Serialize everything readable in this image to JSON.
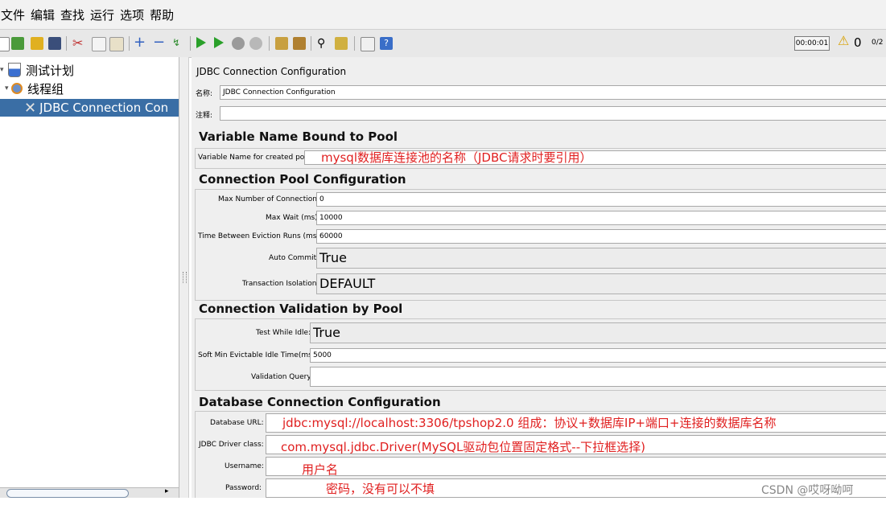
{
  "menu": [
    "文件",
    "编辑",
    "查找",
    "运行",
    "选项",
    "帮助"
  ],
  "toolbar": {
    "timer": "00:00:01",
    "warning_count": "0",
    "threads": "0/2"
  },
  "tree": {
    "items": [
      {
        "label": "测试计划"
      },
      {
        "label": "线程组"
      },
      {
        "label": "JDBC Connection Con"
      }
    ]
  },
  "panel": {
    "title": "JDBC Connection Configuration",
    "name_label": "名称:",
    "name_value": "JDBC Connection Configuration",
    "comment_label": "注释:",
    "comment_value": "",
    "section1": "Variable Name Bound to Pool",
    "var_label": "Variable Name for created pool:",
    "var_note": "mysql数据库连接池的名称（JDBC请求时要引用）",
    "section2": "Connection Pool Configuration",
    "max_conn_label": "Max Number of Connections:",
    "max_conn": "0",
    "max_wait_label": "Max Wait (ms):",
    "max_wait": "10000",
    "eviction_label": "Time Between Eviction Runs (ms):",
    "eviction": "60000",
    "auto_commit_label": "Auto Commit:",
    "auto_commit": "True",
    "isolation_label": "Transaction Isolation:",
    "isolation": "DEFAULT",
    "section3": "Connection Validation by Pool",
    "test_idle_label": "Test While Idle:",
    "test_idle": "True",
    "soft_min_label": "Soft Min Evictable Idle Time(ms):",
    "soft_min": "5000",
    "validation_label": "Validation Query:",
    "validation": "",
    "section4": "Database Connection Configuration",
    "db_url_label": "Database URL:",
    "db_url_note": "jdbc:mysql://localhost:3306/tpshop2.0 组成：协议+数据库IP+端口+连接的数据库名称",
    "driver_label": "JDBC Driver class:",
    "driver_note": "com.mysql.jdbc.Driver(MySQL驱动包位置固定格式--下拉框选择)",
    "username_label": "Username:",
    "username_note": "用户名",
    "password_label": "Password:",
    "password_note": "密码，没有可以不填"
  },
  "watermark": "CSDN @哎呀呦呵"
}
